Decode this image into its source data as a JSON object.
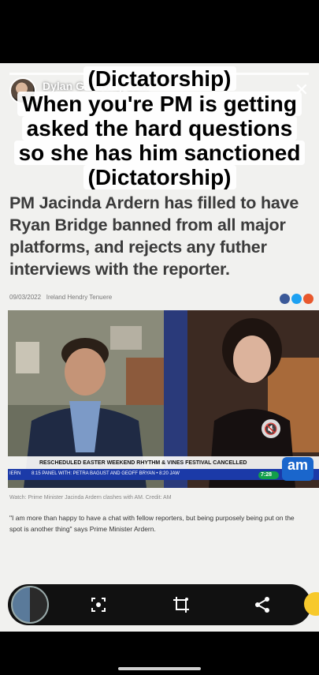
{
  "story": {
    "username": "Dylan Galloway 12m",
    "caption_lines": [
      "(Dictatorship)",
      "When you're PM is getting",
      "asked the hard questions",
      "so she has him sanctioned",
      "(Dictatorship)"
    ]
  },
  "article": {
    "headline": "PM Jacinda Ardern has filled to have Ryan Bridge banned from all major platforms, and rejects any futher interviews with the reporter.",
    "date": "09/03/2022",
    "byline": "Ireland Hendry Tenuere",
    "ticker_main": "RESCHEDULED EASTER WEEKEND RHYTHM & VINES FESTIVAL CANCELLED",
    "ticker_sub": "8:15 PANEL WITH: PETRA BAGUST AND GEOFF BRYAN  •  8:20 JAW",
    "ticker_left": "IERN",
    "clock": "7:28",
    "channel_logo": "am",
    "attribution": "Watch: Prime Minister Jacinda Ardern clashes with AM. Credit: AM",
    "quote": "\"I am more than happy to have a chat with fellow reporters, but being purposely being put on the spot is another thing\" says Prime Minister Ardern."
  },
  "controls": {
    "scan_icon": "scan-icon",
    "crop_icon": "crop-sparkle-icon",
    "share_icon": "share-icon"
  }
}
